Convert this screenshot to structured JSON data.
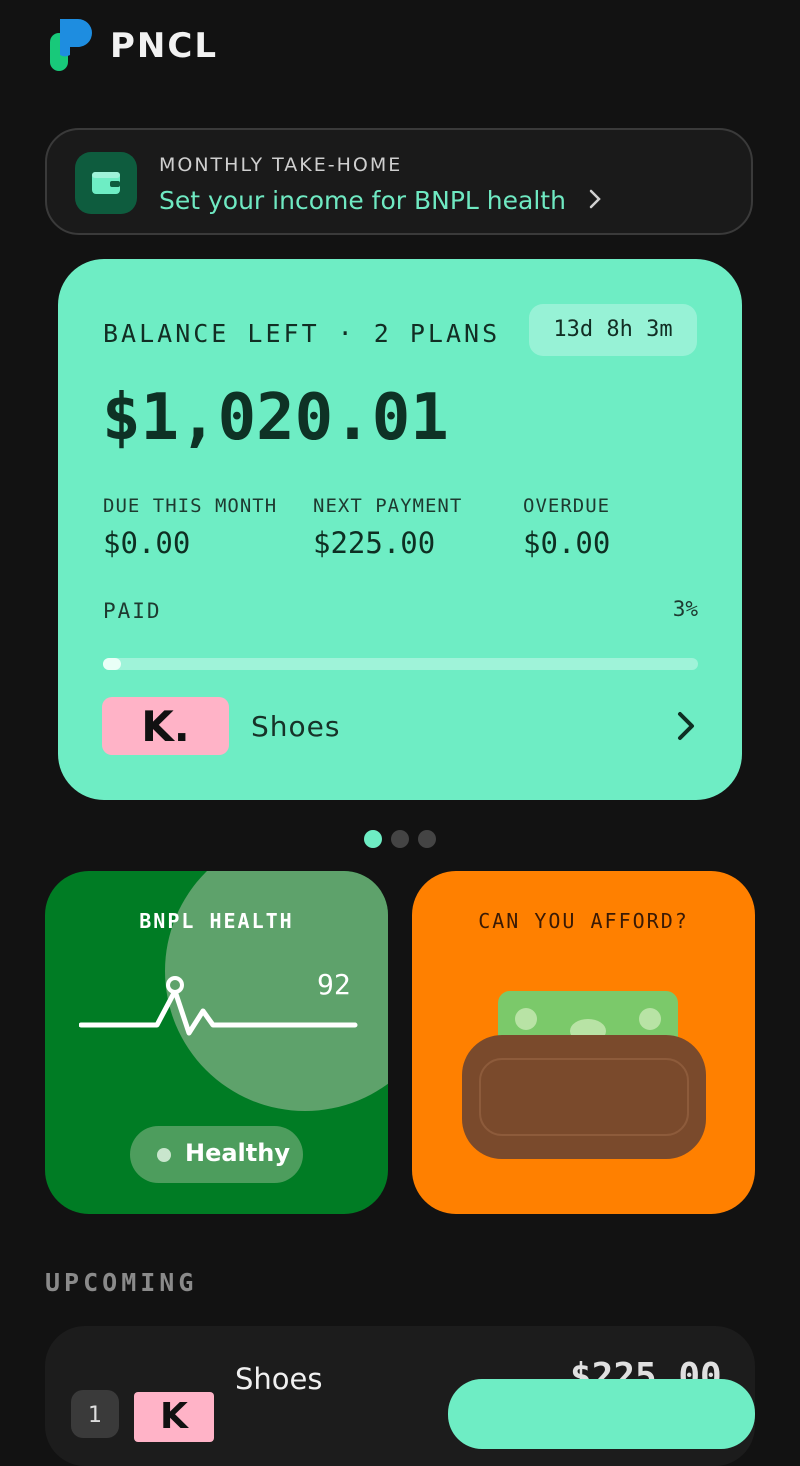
{
  "app": {
    "name": "PNCL",
    "logo_icon": "pncl-logo-icon"
  },
  "income_banner": {
    "icon": "wallet-icon",
    "label": "MONTHLY TAKE-HOME",
    "cta": "Set your income for BNPL health",
    "chevron_icon": "chevron-right-icon"
  },
  "balance_card": {
    "label": "BALANCE LEFT · 2 PLANS",
    "timer": "13d 8h 3m",
    "amount": "$1,020.01",
    "stats": [
      {
        "label": "DUE THIS MONTH",
        "value": "$0.00"
      },
      {
        "label": "NEXT PAYMENT",
        "value": "$225.00"
      },
      {
        "label": "OVERDUE",
        "value": "$0.00"
      }
    ],
    "paid_label": "PAID",
    "paid_percent_text": "3%",
    "paid_fraction": 0.03,
    "provider_logo_text": "K.",
    "plan_name": "Shoes",
    "accent": "#6eedc4"
  },
  "carousel": {
    "page_count": 3,
    "active_index": 0
  },
  "health_tile": {
    "title": "BNPL HEALTH",
    "score": "92",
    "status": "Healthy",
    "color": "#007c24"
  },
  "afford_tile": {
    "title": "CAN YOU AFFORD?",
    "icon": "wallet-cash-icon",
    "color": "#ff8000"
  },
  "upcoming": {
    "label": "UPCOMING",
    "items": [
      {
        "index": "1",
        "provider_logo_text": "K",
        "name": "Shoes",
        "amount": "$225.00"
      }
    ]
  }
}
